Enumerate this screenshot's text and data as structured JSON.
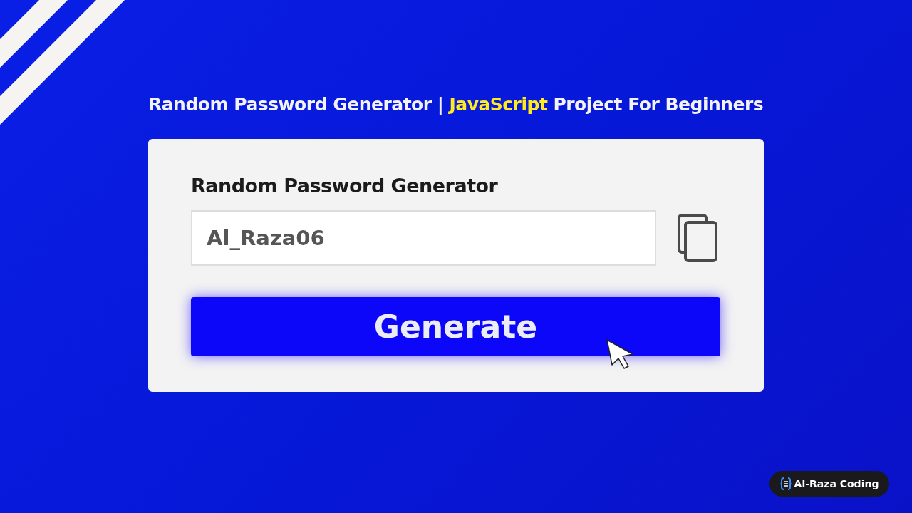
{
  "headline": {
    "parts": [
      {
        "text": "Random Password Generator |",
        "highlight": false
      },
      {
        "text": "JavaScript",
        "highlight": true
      },
      {
        "text": "Project For Beginners",
        "highlight": false
      }
    ]
  },
  "card": {
    "title": "Random Password Generator",
    "password": {
      "value": "Al_Raza06"
    },
    "button": "Generate"
  },
  "badge": {
    "label": "Al-Raza Coding"
  }
}
